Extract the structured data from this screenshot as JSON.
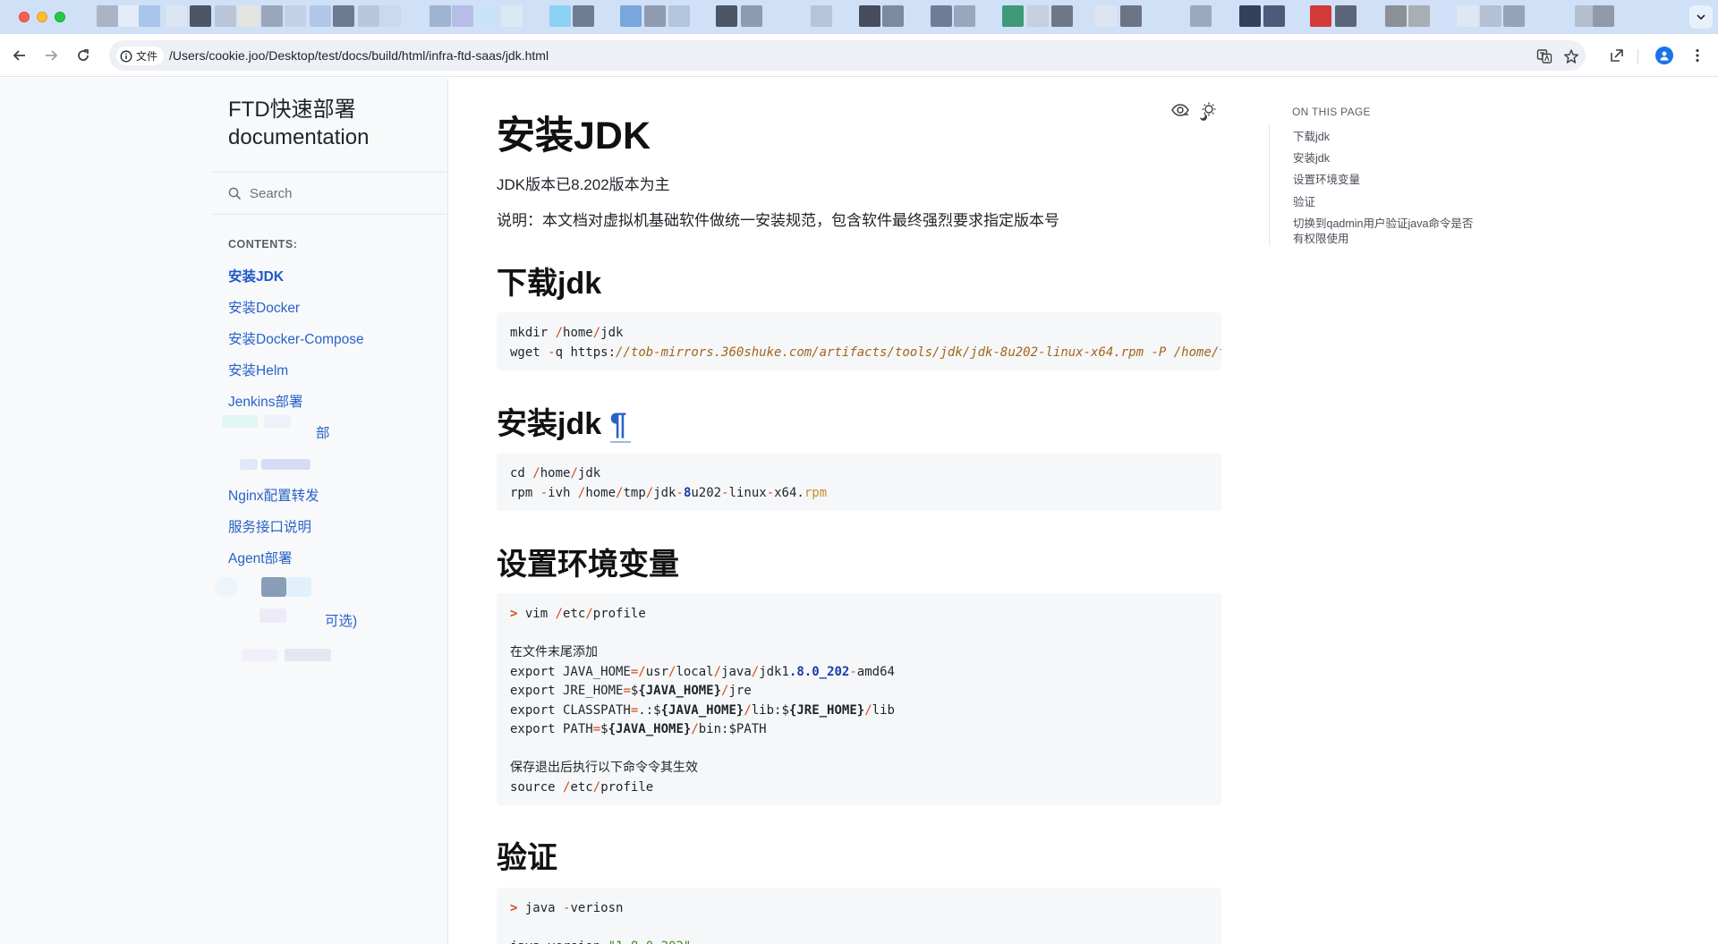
{
  "browser": {
    "url_badge": "文件",
    "url": "/Users/cookie.joo/Desktop/test/docs/build/html/infra-ftd-saas/jdk.html",
    "icons": [
      "back-icon",
      "forward-icon",
      "reload-icon",
      "info-icon",
      "translate-icon",
      "star-icon",
      "extension-icon",
      "profile-icon",
      "more-icon"
    ]
  },
  "sidebar": {
    "brand_line1": "FTD快速部署",
    "brand_line2": "documentation",
    "search_placeholder": "Search",
    "contents_label": "CONTENTS:",
    "items": [
      {
        "label": "安装JDK",
        "active": true
      },
      {
        "label": "安装Docker"
      },
      {
        "label": "安装Docker-Compose"
      },
      {
        "label": "安装Helm"
      },
      {
        "label": "Jenkins部署"
      },
      {
        "label": "部"
      },
      {
        "label": ""
      },
      {
        "label": "Nginx配置转发"
      },
      {
        "label": "服务接口说明"
      },
      {
        "label": "Agent部署"
      },
      {
        "label": ""
      },
      {
        "label": "可选)"
      },
      {
        "label": ""
      }
    ]
  },
  "article": {
    "title": "安装JDK",
    "intro1": "JDK版本已8.202版本为主",
    "intro2": "说明：本文档对虚拟机基础软件做统一安装规范，包含软件最终强烈要求指定版本号",
    "sec1": "下载jdk",
    "sec2": "安装jdk",
    "sec2_link": "¶",
    "sec3": "设置环境变量",
    "sec4": "验证",
    "code_comment_add": "在文件末尾添加",
    "code_comment_save": "保存退出后执行以下命令令其生效"
  },
  "toc": {
    "label": "ON THIS PAGE",
    "items": [
      "下载jdk",
      "安装jdk",
      "设置环境变量",
      "验证",
      "切换到qadmin用户验证java命令是否",
      "有权限使用"
    ]
  }
}
